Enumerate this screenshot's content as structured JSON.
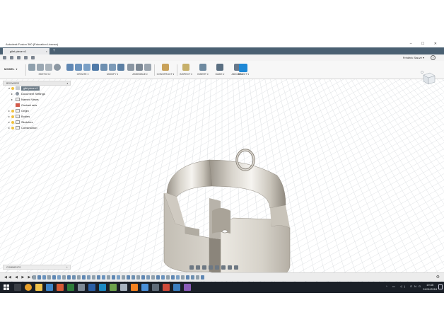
{
  "window": {
    "title": "Autodesk Fusion 360 (Education License)",
    "controls": "–  ☐  ✕"
  },
  "tabs": [
    {
      "label": "gilet piece v1",
      "close": "×"
    }
  ],
  "tab_add": "+",
  "quick_access": {
    "user": "Frédéric Sauvé ▾",
    "help": "?"
  },
  "workspace": {
    "label": "MODEL",
    "caret": "▾"
  },
  "toolbar_groups": [
    {
      "label": "SKETCH ▾"
    },
    {
      "label": "CREATE ▾"
    },
    {
      "label": "MODIFY ▾"
    },
    {
      "label": "ASSEMBLE ▾"
    },
    {
      "label": "CONSTRUCT ▾"
    },
    {
      "label": "INSPECT ▾"
    },
    {
      "label": "INSERT ▾"
    },
    {
      "label": "MAKE ▾"
    },
    {
      "label": "ADD-INS ▾"
    },
    {
      "label": "SELECT ▾"
    }
  ],
  "browser": {
    "header": "BROWSER",
    "pin": "◂",
    "root": "gilet piece v1",
    "items": [
      {
        "label": "Document Settings"
      },
      {
        "label": "Named Views"
      },
      {
        "label": "Contact sets"
      },
      {
        "label": "Origin"
      },
      {
        "label": "Bodies"
      },
      {
        "label": "Sketches"
      },
      {
        "label": "Construction"
      }
    ]
  },
  "comments": {
    "label": "COMMENTS",
    "plus": "+"
  },
  "timeline": {
    "controls": "◀◀ ◀ ▶ ▶▶ ▶▶|",
    "gear": "⚙"
  },
  "taskbar": {
    "tray": "^ ▭ ◁) ENG",
    "time": "19:45",
    "date": "24/11/2018"
  },
  "colors": {
    "tabbar": "#4a6072",
    "select_accent": "#1e88d6",
    "taskbar": "#1a1f27",
    "bulb": "#f0c240"
  }
}
